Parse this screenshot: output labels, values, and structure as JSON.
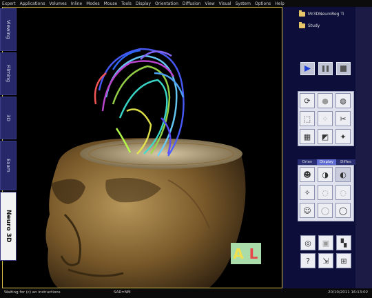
{
  "menu": [
    "Expert",
    "Applications",
    "Volumes",
    "Inline",
    "Modes",
    "Mouse",
    "Tools",
    "Display",
    "Orientation",
    "Diffusion",
    "View",
    "Visual",
    "System",
    "Options",
    "Help"
  ],
  "panel": {
    "items": [
      "Mr3DNeuroReg Ti",
      "Study"
    ]
  },
  "tabs": [
    "Viewing",
    "Filming",
    "3D",
    "Exam",
    "Neuro 3D"
  ],
  "subtabs": [
    "Orien",
    "Display",
    "Diffes"
  ],
  "orientation": {
    "a": "A",
    "l": "L"
  },
  "status": {
    "message": "Waiting for (c) an instructions",
    "mode": "SAR=NM",
    "datetime": "20/10/2011 16:13:02"
  },
  "colors": {
    "accent": "#d6c04a",
    "panel": "#0d0f3a",
    "tab_active": "#f2f2f2"
  }
}
